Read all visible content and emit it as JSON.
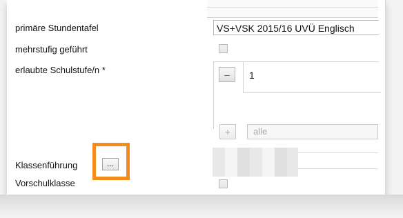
{
  "form": {
    "primary_timetable": {
      "label": "primäre Stundentafel",
      "value": "VS+VSK 2015/16 UVÜ Englisch"
    },
    "multilevel": {
      "label": "mehrstufig geführt",
      "checked": false
    },
    "allowed_levels": {
      "label": "erlaubte Schulstufe/n *",
      "remove_label": "–",
      "value": "1",
      "add_label": "+",
      "add_placeholder": "alle"
    },
    "class_management": {
      "label": "Klassenführung",
      "button_label": "..."
    },
    "preschool_class": {
      "label": "Vorschulklasse",
      "checked": false
    }
  },
  "colors": {
    "highlight": "#f28c1c"
  }
}
